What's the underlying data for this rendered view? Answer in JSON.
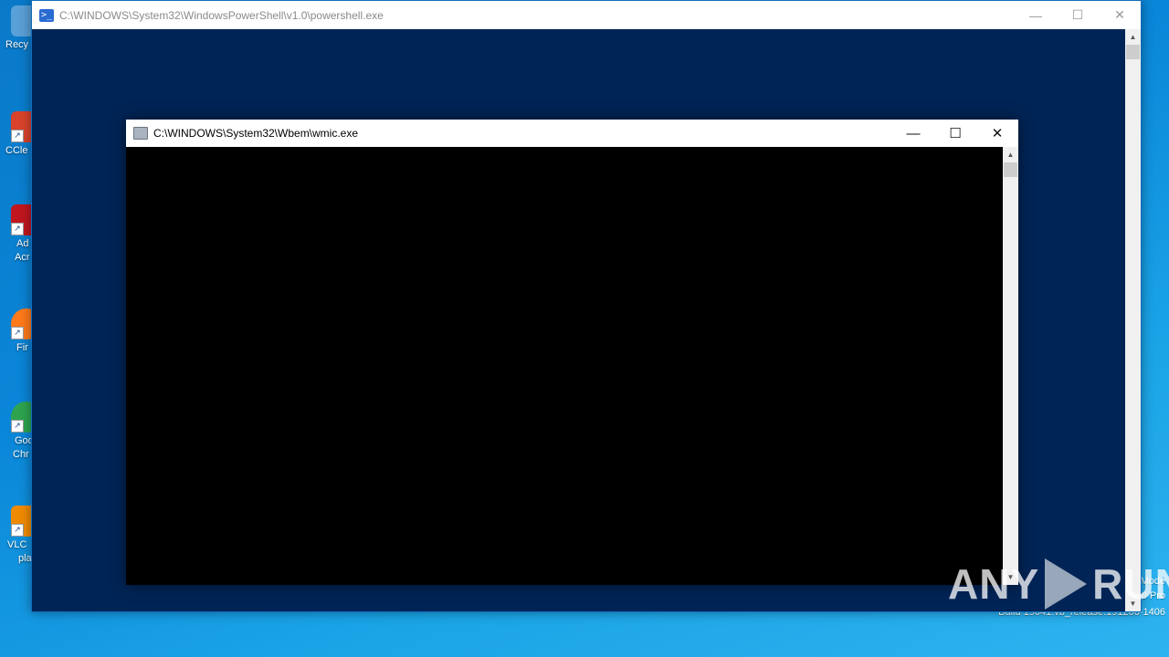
{
  "desktop": {
    "icons": [
      {
        "name": "recycle-bin",
        "label": "Recy",
        "label2": "",
        "color": "#5aa0d8"
      },
      {
        "name": "ccleaner",
        "label": "CCle",
        "label2": "",
        "color": "#d9432b"
      },
      {
        "name": "adobe-acrobat",
        "label": "Ad",
        "label2": "Acr",
        "color": "#c1161e"
      },
      {
        "name": "firefox",
        "label": "Fir",
        "label2": "",
        "color": "#ff7a1a"
      },
      {
        "name": "google-chrome",
        "label": "Goo",
        "label2": "Chr",
        "color": "#2ea44f"
      },
      {
        "name": "vlc-player",
        "label": "VLC",
        "label2": "pla",
        "color": "#f08a00"
      }
    ],
    "build_lines": [
      "Mode",
      "0 Pro",
      "Build 19041.vb_release.191206-1406"
    ]
  },
  "powershell_window": {
    "title": "C:\\WINDOWS\\System32\\WindowsPowerShell\\v1.0\\powershell.exe",
    "icon": "powershell-icon",
    "background": "#012456"
  },
  "wmic_window": {
    "title": "C:\\WINDOWS\\System32\\Wbem\\wmic.exe",
    "icon": "console-icon"
  },
  "controls": {
    "minimize": "—",
    "maximize": "☐",
    "close": "✕"
  },
  "watermark": {
    "left": "ANY",
    "right": "RUN"
  }
}
